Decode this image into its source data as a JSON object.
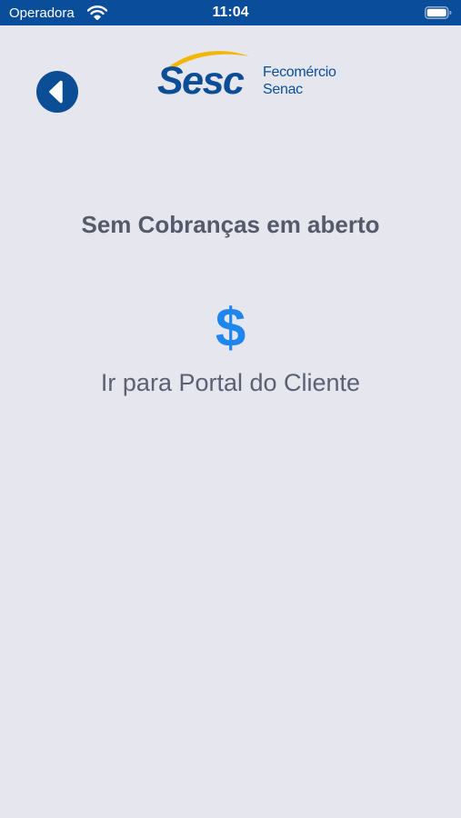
{
  "status_bar": {
    "carrier": "Operadora",
    "time": "11:04",
    "wifi_icon": "wifi-icon",
    "battery_icon": "battery-icon"
  },
  "header": {
    "back_icon": "chevron-left-icon",
    "logo": {
      "name": "Sesc",
      "line1": "Fecomércio",
      "line2": "Senac"
    }
  },
  "main": {
    "title": "Sem Cobranças em aberto",
    "portal_link": {
      "icon": "$",
      "icon_name": "dollar-icon",
      "label": "Ir para Portal do Cliente"
    }
  },
  "colors": {
    "status_bar": "#0a4d9a",
    "background": "#e6e7ee",
    "brand_blue": "#0b4e96",
    "brand_yellow": "#f2b705",
    "accent": "#1f86f0",
    "text": "#555a6b"
  }
}
